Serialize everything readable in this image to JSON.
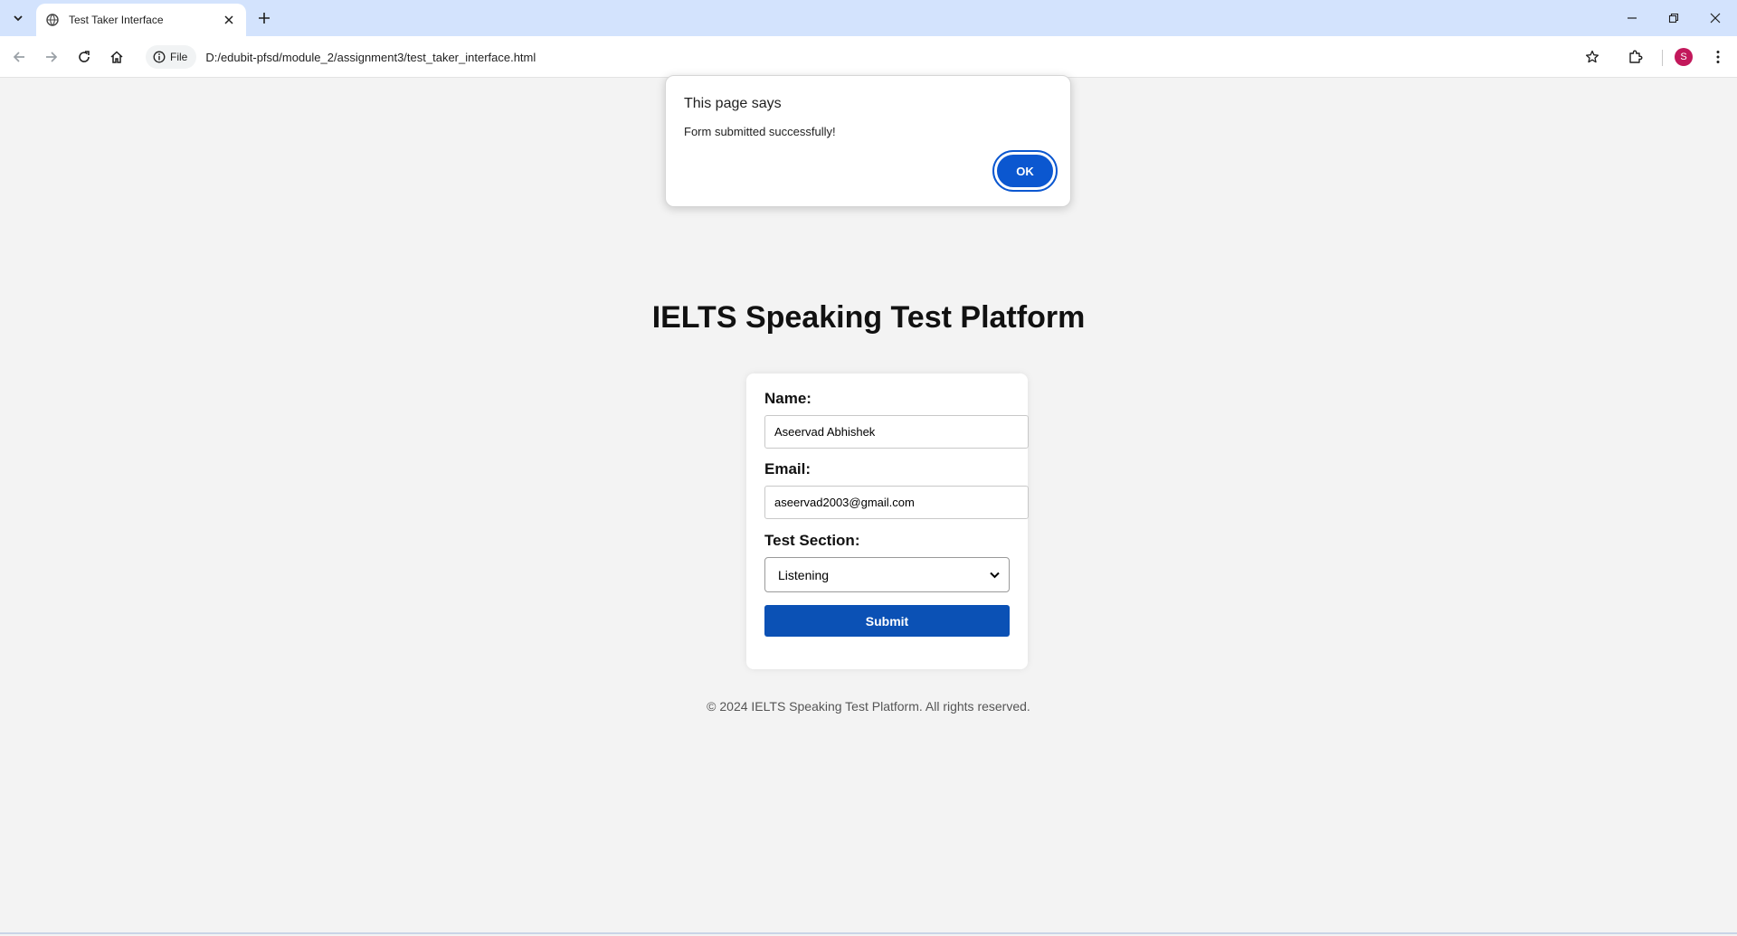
{
  "browser": {
    "tab_title": "Test Taker Interface",
    "site_chip_label": "File",
    "url": "D:/edubit-pfsd/module_2/assignment3/test_taker_interface.html",
    "profile_initial": "S"
  },
  "page": {
    "title": "IELTS Speaking Test Platform",
    "form": {
      "name_label": "Name:",
      "name_value": "Aseervad Abhishek",
      "email_label": "Email:",
      "email_value": "aseervad2003@gmail.com",
      "section_label": "Test Section:",
      "section_value": "Listening",
      "submit_label": "Submit"
    },
    "footer": "© 2024 IELTS Speaking Test Platform. All rights reserved."
  },
  "alert": {
    "title": "This page says",
    "message": "Form submitted successfully!",
    "ok_label": "OK"
  },
  "colors": {
    "accent": "#0b57d0",
    "submit": "#0b51b5",
    "page_background": "#f3f3f3",
    "tabstrip": "#d3e3fd",
    "avatar": "#c2185b"
  }
}
